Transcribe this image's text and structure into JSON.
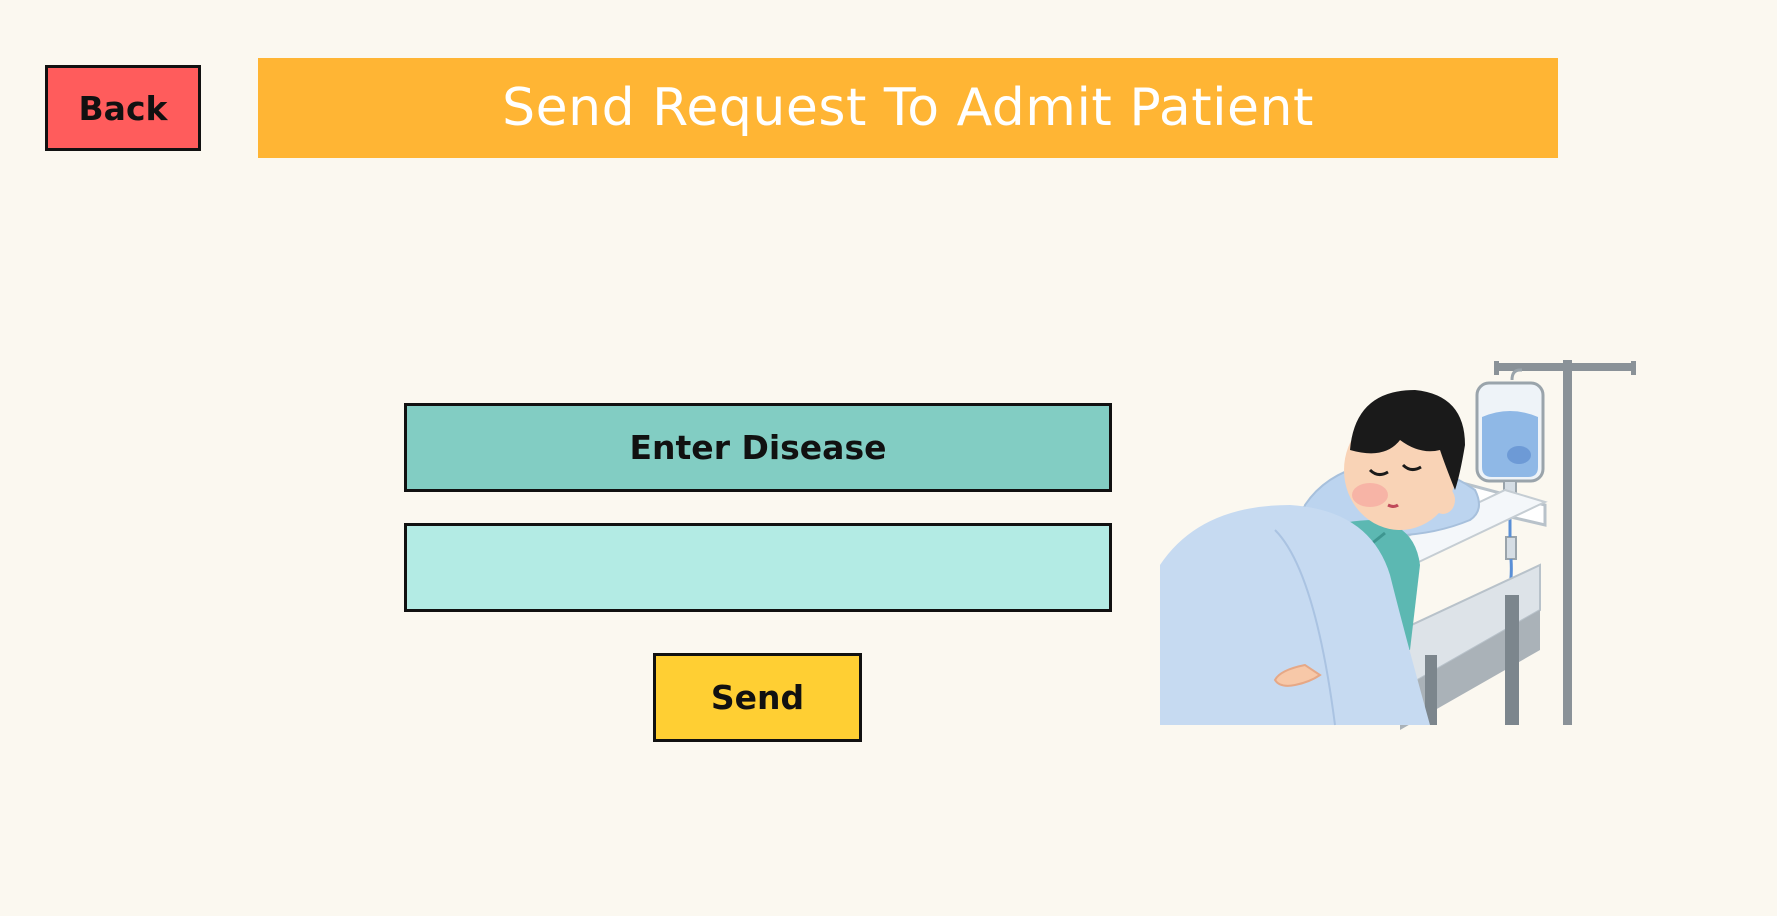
{
  "header": {
    "back_label": "Back",
    "title": "Send Request To Admit Patient"
  },
  "form": {
    "disease_label": "Enter Disease",
    "disease_value": "",
    "disease_placeholder": "",
    "send_label": "Send"
  },
  "illustration": {
    "icon": "patient-in-hospital-bed-icon"
  },
  "colors": {
    "background": "#fbf8f0",
    "back_button": "#ff5c5c",
    "title_bar": "#ffb534",
    "label_box": "#82cdc3",
    "input_box": "#b3ebe4",
    "send_button": "#ffcf33"
  }
}
